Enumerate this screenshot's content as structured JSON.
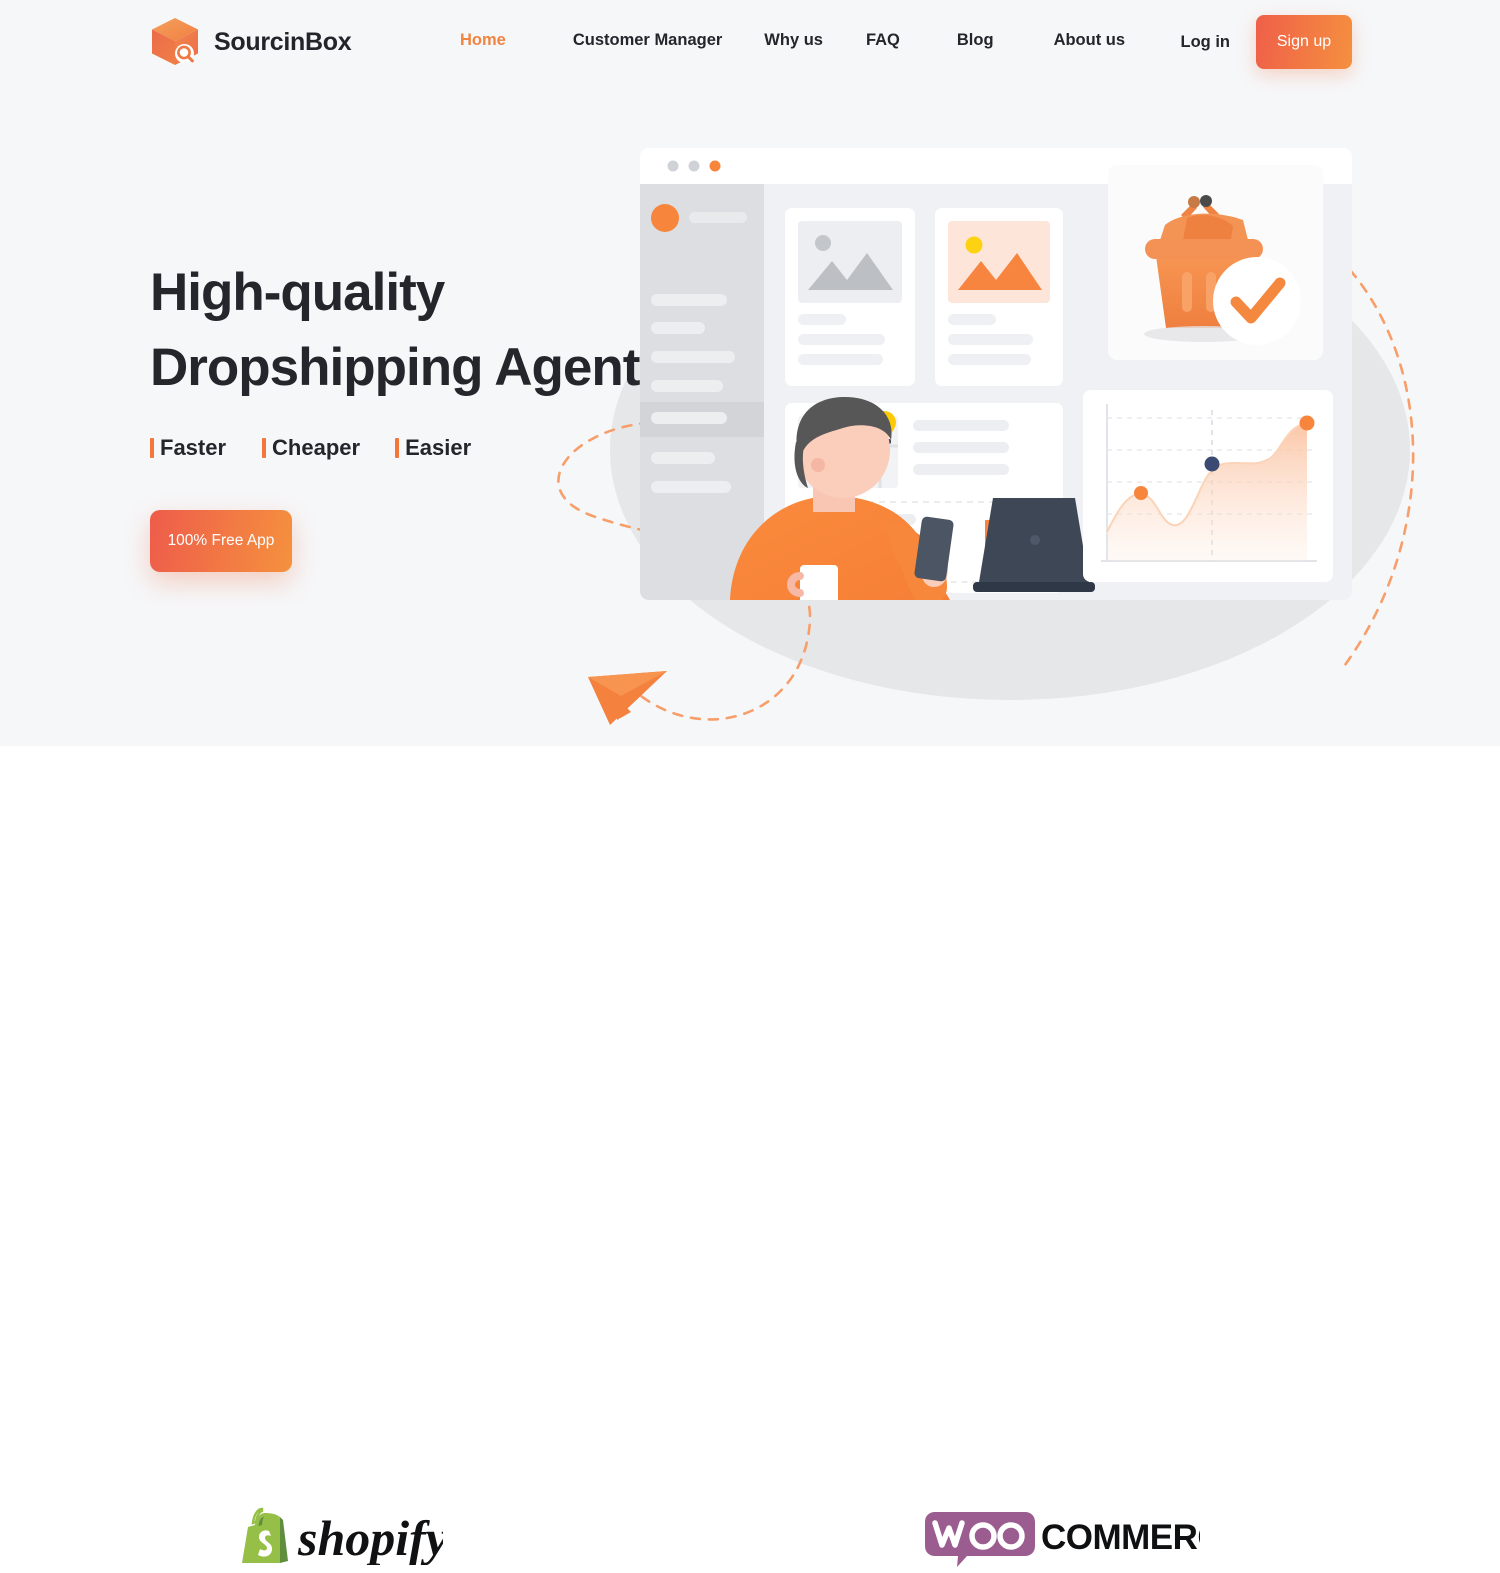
{
  "brand": {
    "name": "SourcinBox",
    "logo_icon": "box-magnifier-icon",
    "accent_color": "#f0833f"
  },
  "nav": {
    "links": [
      {
        "label": "Home",
        "active": true
      },
      {
        "label": "Customer Manager",
        "active": false
      },
      {
        "label": "Why us",
        "active": false
      },
      {
        "label": "FAQ",
        "active": false
      },
      {
        "label": "Blog",
        "active": false
      },
      {
        "label": "About us",
        "active": false
      }
    ],
    "login_label": "Log in",
    "signup_label": "Sign up"
  },
  "hero": {
    "headline_line1": "High-quality",
    "headline_line2": "Dropshipping Agent",
    "features": [
      "Faster",
      "Cheaper",
      "Easier"
    ],
    "cta_label": "100% Free App",
    "illustration_name": "dropshipping-dashboard-illustration",
    "colors": {
      "background": "#f6f7f9",
      "gradient_start": "#ee5c4b",
      "gradient_end": "#f5913e",
      "text": "#24262b"
    }
  },
  "partners": [
    {
      "name": "shopify",
      "label": "shopify",
      "color": "#95bf46"
    },
    {
      "name": "woocommerce",
      "label": "WOO COMMERCE",
      "color": "#9b5c8f"
    }
  ]
}
